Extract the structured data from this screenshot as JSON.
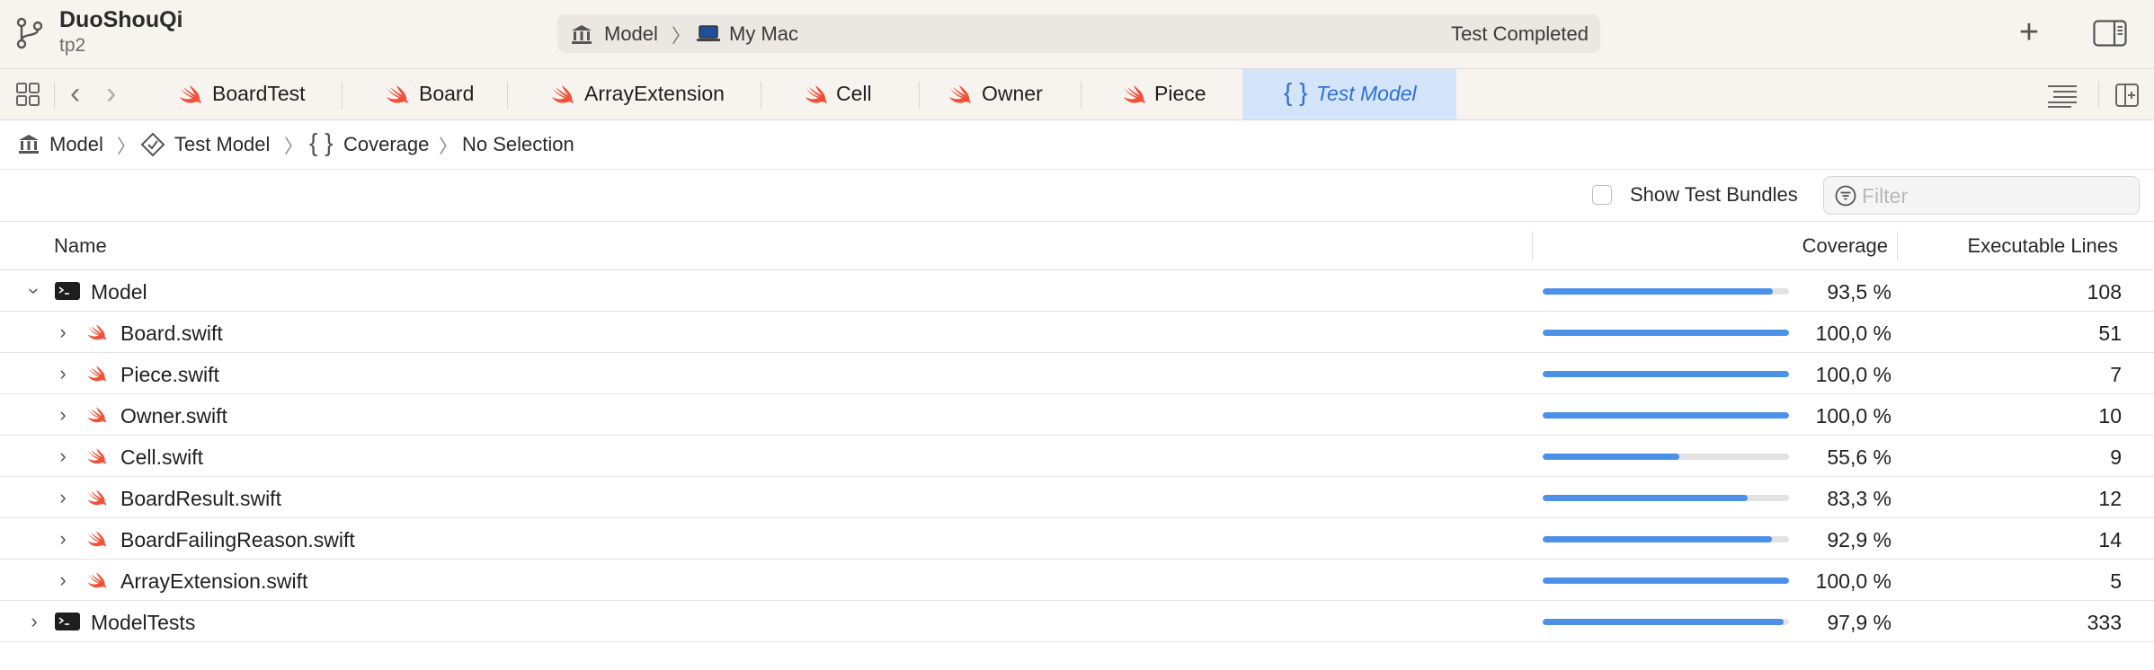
{
  "colors": {
    "accent": "#2f6fd6",
    "active_tab_bg": "#d4e5fb",
    "coverage_bar": "#4b91e8",
    "swift_orange": "#f05138"
  },
  "window": {
    "project_name": "DuoShouQi",
    "project_branch": "tp2",
    "activity": {
      "scheme": "Model",
      "destination": "My Mac",
      "status": "Test Completed"
    }
  },
  "tabs": [
    {
      "label": "BoardTest",
      "icon": "swift-icon"
    },
    {
      "label": "Board",
      "icon": "swift-icon"
    },
    {
      "label": "ArrayExtension",
      "icon": "swift-icon"
    },
    {
      "label": "Cell",
      "icon": "swift-icon"
    },
    {
      "label": "Owner",
      "icon": "swift-icon"
    },
    {
      "label": "Piece",
      "icon": "swift-icon"
    },
    {
      "label": "Test Model",
      "icon": "braces-icon",
      "active": true
    }
  ],
  "breadcrumb": {
    "items": [
      "Model",
      "Test Model",
      "Coverage",
      "No Selection"
    ]
  },
  "filter": {
    "show_test_bundles_label": "Show Test Bundles",
    "show_test_bundles_checked": false,
    "placeholder": "Filter"
  },
  "table": {
    "columns": {
      "name": "Name",
      "coverage": "Coverage",
      "executable_lines": "Executable Lines"
    },
    "rows": [
      {
        "name": "Model",
        "kind": "target",
        "expanded": true,
        "coverage": "93,5 %",
        "coverage_fraction": 0.935,
        "lines": "108"
      },
      {
        "name": "Board.swift",
        "kind": "file",
        "coverage": "100,0 %",
        "coverage_fraction": 1.0,
        "lines": "51"
      },
      {
        "name": "Piece.swift",
        "kind": "file",
        "coverage": "100,0 %",
        "coverage_fraction": 1.0,
        "lines": "7"
      },
      {
        "name": "Owner.swift",
        "kind": "file",
        "coverage": "100,0 %",
        "coverage_fraction": 1.0,
        "lines": "10"
      },
      {
        "name": "Cell.swift",
        "kind": "file",
        "coverage": "55,6 %",
        "coverage_fraction": 0.556,
        "lines": "9"
      },
      {
        "name": "BoardResult.swift",
        "kind": "file",
        "coverage": "83,3 %",
        "coverage_fraction": 0.833,
        "lines": "12"
      },
      {
        "name": "BoardFailingReason.swift",
        "kind": "file",
        "coverage": "92,9 %",
        "coverage_fraction": 0.929,
        "lines": "14"
      },
      {
        "name": "ArrayExtension.swift",
        "kind": "file",
        "coverage": "100,0 %",
        "coverage_fraction": 1.0,
        "lines": "5"
      },
      {
        "name": "ModelTests",
        "kind": "target",
        "expanded": false,
        "coverage": "97,9 %",
        "coverage_fraction": 0.979,
        "lines": "333"
      }
    ]
  }
}
